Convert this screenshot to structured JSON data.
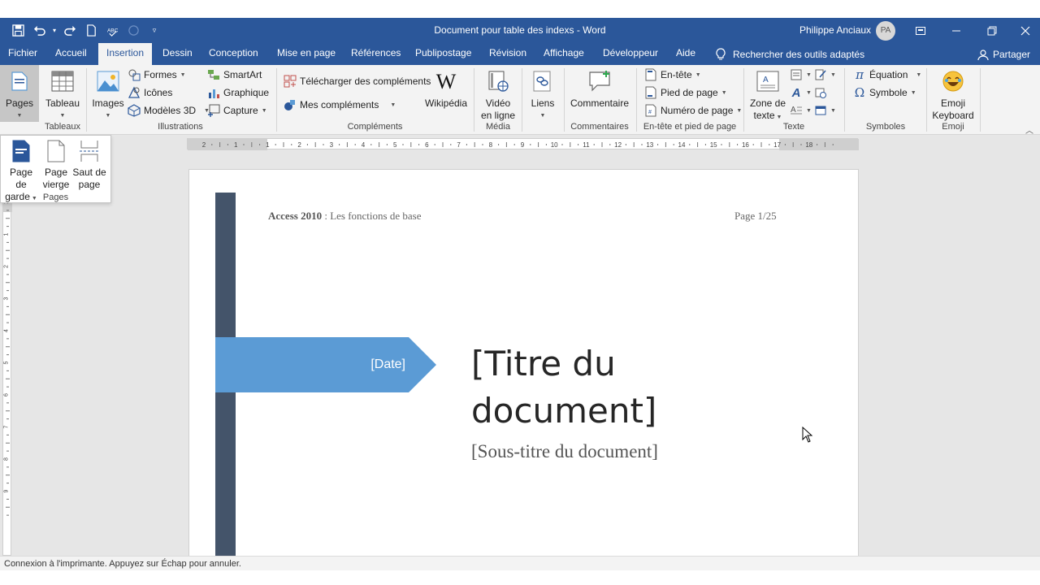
{
  "window": {
    "title": "Document pour table des indexs - Word",
    "user_name": "Philippe Anciaux",
    "user_initials": "PA"
  },
  "tabs": [
    {
      "label": "Fichier"
    },
    {
      "label": "Accueil"
    },
    {
      "label": "Insertion",
      "active": true
    },
    {
      "label": "Dessin"
    },
    {
      "label": "Conception"
    },
    {
      "label": "Mise en page"
    },
    {
      "label": "Références"
    },
    {
      "label": "Publipostage"
    },
    {
      "label": "Révision"
    },
    {
      "label": "Affichage"
    },
    {
      "label": "Développeur"
    },
    {
      "label": "Aide"
    }
  ],
  "search_label": "Rechercher des outils adaptés",
  "share_label": "Partager",
  "ribbon": {
    "pages": {
      "label": "Pages"
    },
    "tableau": {
      "label": "Tableau",
      "group": "Tableaux"
    },
    "illustrations": {
      "images": "Images",
      "formes": "Formes",
      "icones": "Icônes",
      "modeles3d": "Modèles 3D",
      "smartart": "SmartArt",
      "graphique": "Graphique",
      "capture": "Capture",
      "group": "Illustrations"
    },
    "complements": {
      "telecharger": "Télécharger des compléments",
      "mes": "Mes compléments",
      "wikipedia": "Wikipédia",
      "group": "Compléments"
    },
    "media": {
      "video_line1": "Vidéo",
      "video_line2": "en ligne",
      "group": "Média"
    },
    "liens": {
      "label": "Liens"
    },
    "commentaires": {
      "label": "Commentaire",
      "group": "Commentaires"
    },
    "entete": {
      "entete": "En-tête",
      "pied": "Pied de page",
      "numero": "Numéro de page",
      "group": "En-tête et pied de page"
    },
    "texte": {
      "zone_line1": "Zone de",
      "zone_line2": "texte",
      "group": "Texte"
    },
    "symboles": {
      "equation": "Équation",
      "symbole": "Symbole",
      "group": "Symboles"
    },
    "emoji": {
      "line1": "Emoji",
      "line2": "Keyboard",
      "group": "Emoji"
    }
  },
  "pages_dropdown": {
    "items": [
      {
        "line1": "Page de",
        "line2": "garde"
      },
      {
        "line1": "Page",
        "line2": "vierge"
      },
      {
        "line1": "Saut de",
        "line2": "page"
      }
    ],
    "label": "Pages"
  },
  "ruler": {
    "h_ticks": [
      "2",
      "1",
      "1",
      "2",
      "3",
      "4",
      "5",
      "6",
      "7",
      "8",
      "9",
      "10",
      "11",
      "12",
      "13",
      "14",
      "15",
      "16",
      "17",
      "18"
    ],
    "v_ticks": [
      "1",
      "1",
      "2",
      "3",
      "4",
      "5",
      "6",
      "7",
      "8",
      "9"
    ]
  },
  "document": {
    "header_bold": "Access 2010",
    "header_rest": " : Les fonctions de base",
    "page_number": "Page 1/25",
    "date": "[Date]",
    "title_line1": "[Titre du",
    "title_line2": "document]",
    "subtitle": "[Sous-titre du document]"
  },
  "status_text": "Connexion à l'imprimante. Appuyez sur Échap pour annuler.",
  "colors": {
    "word_blue": "#2b579a",
    "accent_band": "#44546a",
    "date_banner": "#5b9bd5"
  }
}
